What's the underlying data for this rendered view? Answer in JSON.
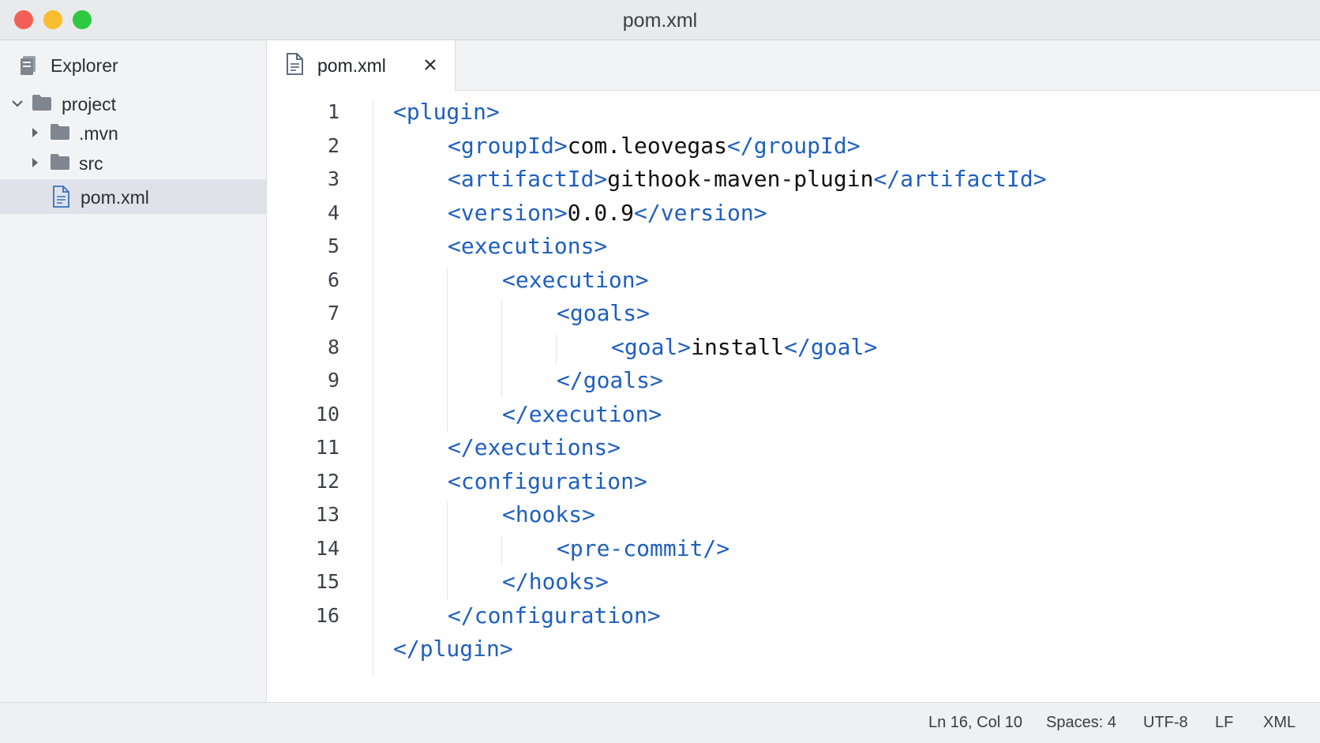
{
  "window": {
    "title": "pom.xml"
  },
  "sidebar": {
    "header": "Explorer",
    "tree": [
      {
        "label": "project",
        "type": "folder",
        "expanded": true
      },
      {
        "label": ".mvn",
        "type": "folder",
        "expanded": false
      },
      {
        "label": "src",
        "type": "folder",
        "expanded": false
      },
      {
        "label": "pom.xml",
        "type": "file",
        "selected": true
      }
    ]
  },
  "tabs": [
    {
      "label": "pom.xml",
      "active": true
    }
  ],
  "editor": {
    "line_numbers": [
      "1",
      "2",
      "3",
      "4",
      "5",
      "6",
      "7",
      "8",
      "9",
      "10",
      "11",
      "12",
      "13",
      "14",
      "15",
      "16"
    ],
    "lines": [
      {
        "indent": 0,
        "open": "<plugin>",
        "text": "",
        "close": ""
      },
      {
        "indent": 1,
        "open": "<groupId>",
        "text": "com.leovegas",
        "close": "</groupId>"
      },
      {
        "indent": 1,
        "open": "<artifactId>",
        "text": "githook-maven-plugin",
        "close": "</artifactId>"
      },
      {
        "indent": 1,
        "open": "<version>",
        "text": "0.0.9",
        "close": "</version>"
      },
      {
        "indent": 1,
        "open": "<executions>",
        "text": "",
        "close": ""
      },
      {
        "indent": 2,
        "open": "<execution>",
        "text": "",
        "close": ""
      },
      {
        "indent": 3,
        "open": "<goals>",
        "text": "",
        "close": ""
      },
      {
        "indent": 4,
        "open": "<goal>",
        "text": "install",
        "close": "</goal>"
      },
      {
        "indent": 3,
        "open": "</goals>",
        "text": "",
        "close": ""
      },
      {
        "indent": 2,
        "open": "</execution>",
        "text": "",
        "close": ""
      },
      {
        "indent": 1,
        "open": "</executions>",
        "text": "",
        "close": ""
      },
      {
        "indent": 1,
        "open": "<configuration>",
        "text": "",
        "close": ""
      },
      {
        "indent": 2,
        "open": "<hooks>",
        "text": "",
        "close": ""
      },
      {
        "indent": 3,
        "open": "<pre-commit/>",
        "text": "",
        "close": ""
      },
      {
        "indent": 2,
        "open": "</hooks>",
        "text": "",
        "close": ""
      },
      {
        "indent": 1,
        "open": "</configuration>",
        "text": "",
        "close": ""
      },
      {
        "indent": 0,
        "open": "</plugin>",
        "text": "",
        "close": ""
      }
    ]
  },
  "status": {
    "position": "Ln 16, Col 10",
    "spaces": "Spaces: 4",
    "encoding": "UTF-8",
    "eol": "LF",
    "language": "XML"
  },
  "colors": {
    "tag": "#1f5fbf",
    "text": "#111111",
    "selection": "#dfe3e9"
  },
  "icons": {
    "sidebar_header": "explorer-icon",
    "folder": "folder-icon",
    "file": "file-icon",
    "expanded": "chevron-down-icon",
    "collapsed": "chevron-right-icon",
    "close": "close-icon"
  }
}
